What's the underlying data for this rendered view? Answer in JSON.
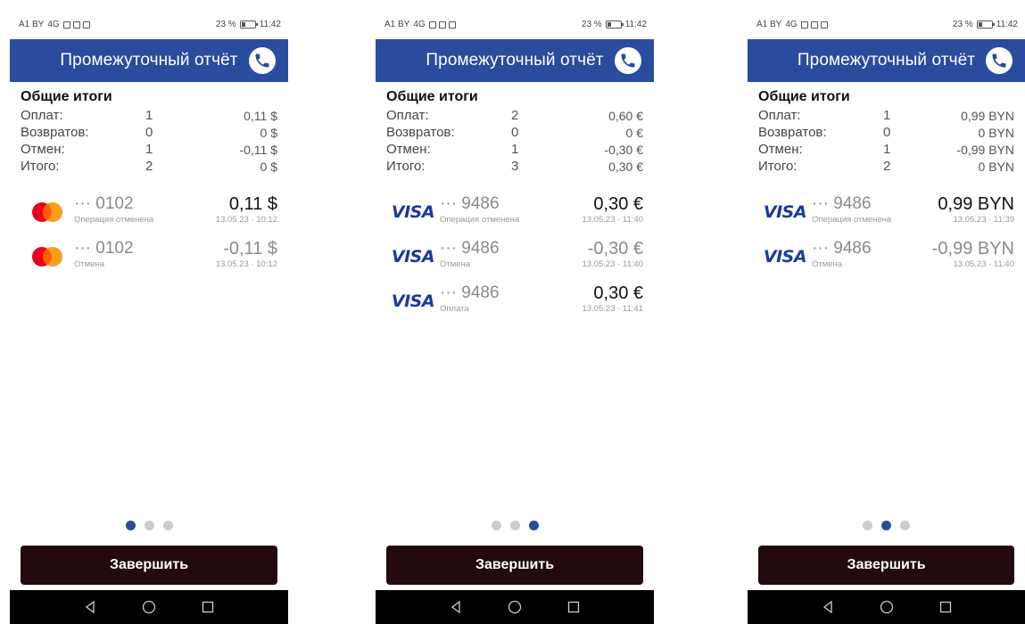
{
  "colors": {
    "header": "#2a4c9e",
    "button": "#220a0e",
    "visa": "#1a3a9e",
    "mc_red": "#eb001b",
    "mc_orange": "#f79e1b"
  },
  "status_bar": {
    "carrier": "A1 BY",
    "signal": "4G",
    "battery_percent": "23 %",
    "time": "11:42"
  },
  "header": {
    "title": "Промежуточный отчёт",
    "call_icon": "phone-icon"
  },
  "totals": {
    "title": "Общие итоги",
    "labels": {
      "payments": "Оплат:",
      "refunds": "Возвратов:",
      "cancels": "Отмен:",
      "total": "Итого:"
    }
  },
  "finish_label": "Завершить",
  "nav": {
    "back": "back-icon",
    "home": "home-icon",
    "recents": "recents-icon"
  },
  "screens": [
    {
      "page_index": 0,
      "page_count": 3,
      "totals": {
        "payments": {
          "count": "1",
          "amount": "0,11 $"
        },
        "refunds": {
          "count": "0",
          "amount": "0 $"
        },
        "cancels": {
          "count": "1",
          "amount": "-0,11 $"
        },
        "total": {
          "count": "2",
          "amount": "0 $"
        }
      },
      "transactions": [
        {
          "brand": "mastercard",
          "card": "··· 0102",
          "status": "Операция отменена",
          "amount": "0,11 $",
          "date": "13.05.23 · 10:12",
          "muted": false
        },
        {
          "brand": "mastercard",
          "card": "··· 0102",
          "status": "Отмена",
          "amount": "-0,11 $",
          "date": "13.05.23 · 10:12",
          "muted": true
        }
      ]
    },
    {
      "page_index": 2,
      "page_count": 3,
      "totals": {
        "payments": {
          "count": "2",
          "amount": "0,60 €"
        },
        "refunds": {
          "count": "0",
          "amount": "0 €"
        },
        "cancels": {
          "count": "1",
          "amount": "-0,30 €"
        },
        "total": {
          "count": "3",
          "amount": "0,30 €"
        }
      },
      "transactions": [
        {
          "brand": "visa",
          "card": "··· 9486",
          "status": "Операция отменена",
          "amount": "0,30 €",
          "date": "13.05.23 · 11:40",
          "muted": false
        },
        {
          "brand": "visa",
          "card": "··· 9486",
          "status": "Отмена",
          "amount": "-0,30 €",
          "date": "13.05.23 · 11:40",
          "muted": true
        },
        {
          "brand": "visa",
          "card": "··· 9486",
          "status": "Оплата",
          "amount": "0,30 €",
          "date": "13.05.23 · 11:41",
          "muted": false
        }
      ]
    },
    {
      "page_index": 1,
      "page_count": 3,
      "totals": {
        "payments": {
          "count": "1",
          "amount": "0,99 BYN"
        },
        "refunds": {
          "count": "0",
          "amount": "0 BYN"
        },
        "cancels": {
          "count": "1",
          "amount": "-0,99 BYN"
        },
        "total": {
          "count": "2",
          "amount": "0 BYN"
        }
      },
      "transactions": [
        {
          "brand": "visa",
          "card": "··· 9486",
          "status": "Операция отменена",
          "amount": "0,99 BYN",
          "date": "13.05.23 · 11:39",
          "muted": false
        },
        {
          "brand": "visa",
          "card": "··· 9486",
          "status": "Отмена",
          "amount": "-0,99 BYN",
          "date": "13.05.23 · 11:40",
          "muted": true
        }
      ]
    }
  ]
}
